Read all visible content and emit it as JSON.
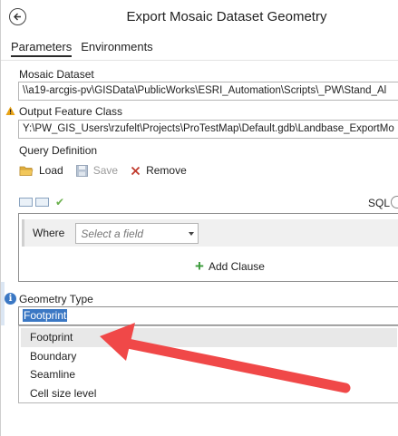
{
  "window": {
    "title": "Export Mosaic Dataset Geometry"
  },
  "tabs": [
    {
      "label": "Parameters",
      "active": true
    },
    {
      "label": "Environments",
      "active": false
    }
  ],
  "mosaic_dataset": {
    "label": "Mosaic Dataset",
    "value": "\\\\a19-arcgis-pv\\GISData\\PublicWorks\\ESRI_Automation\\Scripts\\_PW\\Stand_Al"
  },
  "output_feature_class": {
    "label": "Output Feature Class",
    "value": "Y:\\PW_GIS_Users\\rzufelt\\Projects\\ProTestMap\\Default.gdb\\Landbase_ExportMo"
  },
  "query_definition": {
    "label": "Query Definition",
    "load_label": "Load",
    "save_label": "Save",
    "remove_label": "Remove",
    "sql_label": "SQL",
    "where_label": "Where",
    "field_placeholder": "Select a field",
    "add_clause_label": "Add Clause"
  },
  "geometry_type": {
    "label": "Geometry Type",
    "selected": "Footprint",
    "options": [
      "Footprint",
      "Boundary",
      "Seamline",
      "Cell size level"
    ]
  },
  "colors": {
    "accent": "#3b78c4",
    "annotation_arrow": "#f04848",
    "warning": "#e8a317",
    "add_green": "#3a9a3a",
    "remove_red": "#c0392b"
  },
  "icons": {
    "back": "back-arrow-circle-icon",
    "warning": "warning-triangle-icon",
    "info": "info-icon",
    "load": "folder-icon",
    "save": "save-disk-icon",
    "remove": "x-icon",
    "add": "plus-icon",
    "annotation": "annotation-arrow"
  }
}
